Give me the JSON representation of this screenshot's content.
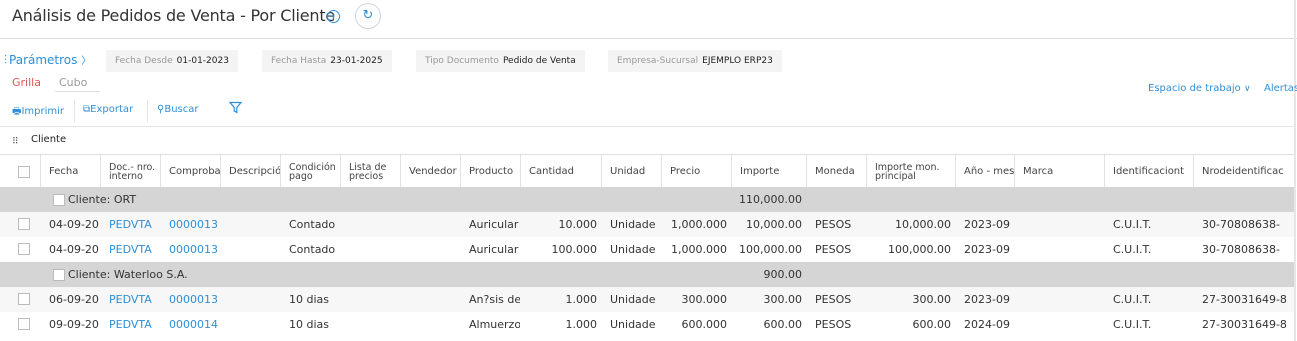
{
  "header": {
    "title": "Análisis de Pedidos de Venta - Por Cliente",
    "info_icon": "i",
    "refresh_icon": "↻"
  },
  "params": {
    "label": "Parámetros",
    "icon": "⫶",
    "chevron": "〉",
    "filters": [
      {
        "label": "Fecha Desde",
        "value": "01-01-2023"
      },
      {
        "label": "Fecha Hasta",
        "value": "23-01-2025"
      },
      {
        "label": "Tipo Documento",
        "value": "Pedido de Venta"
      },
      {
        "label": "Empresa-Sucursal",
        "value": "EJEMPLO ERP23"
      }
    ]
  },
  "tabs": {
    "grilla": "Grilla",
    "cubo": "Cubo",
    "active": "Grilla"
  },
  "toolbar": {
    "print": "Imprimir",
    "export": "Exportar",
    "search": "Buscar",
    "filter_icon": "funnel-icon",
    "workspace": "Espacio de trabajo",
    "alerts": "Alertas"
  },
  "grouping": {
    "label": "Cliente"
  },
  "columns": [
    "Fecha",
    "Doc.- nro. interno",
    "Comprobante",
    "Descripción",
    "Condición pago",
    "Lista de precios",
    "Vendedor",
    "Producto",
    "Cantidad",
    "Unidad",
    "Precio",
    "Importe",
    "Moneda",
    "Importe mon. principal",
    "Año - mes",
    "Marca",
    "Identificacion",
    "Nrodeidentificacion"
  ],
  "column_display": {
    "Comprobante": "Comproba",
    "Descripción": "Descripció",
    "Identificacion": "Identificaciont",
    "Nrodeidentificacion": "Nrodeidentificac"
  },
  "groups": [
    {
      "label": "Cliente: ORT",
      "total": "110,000.00",
      "rows": [
        {
          "fecha": "04-09-20",
          "doc": "PEDVTA",
          "comp": "0000013",
          "cond": "Contado",
          "prod": "Auricular",
          "cant": "10.000",
          "unidad": "Unidade",
          "precio": "1,000.000",
          "importe": "10,000.00",
          "moneda": "PESOS",
          "imp_pr": "10,000.00",
          "anio": "2023-09",
          "ident": "C.U.I.T.",
          "nro": "30-70808638-"
        },
        {
          "fecha": "04-09-20",
          "doc": "PEDVTA",
          "comp": "0000013",
          "cond": "Contado",
          "prod": "Auricular",
          "cant": "100.000",
          "unidad": "Unidade",
          "precio": "1,000.000",
          "importe": "100,000.00",
          "moneda": "PESOS",
          "imp_pr": "100,000.00",
          "anio": "2023-09",
          "ident": "C.U.I.T.",
          "nro": "30-70808638-"
        }
      ]
    },
    {
      "label": "Cliente: Waterloo S.A.",
      "total": "900.00",
      "rows": [
        {
          "fecha": "06-09-20",
          "doc": "PEDVTA",
          "comp": "0000013",
          "cond": "10 dias",
          "prod": "An?sis de",
          "cant": "1.000",
          "unidad": "Unidade",
          "precio": "300.000",
          "importe": "300.00",
          "moneda": "PESOS",
          "imp_pr": "300.00",
          "anio": "2023-09",
          "ident": "C.U.I.T.",
          "nro": "27-30031649-8"
        },
        {
          "fecha": "09-09-20",
          "doc": "PEDVTA",
          "comp": "0000014",
          "cond": "10 dias",
          "prod": "Almuerzo",
          "cant": "1.000",
          "unidad": "Unidade",
          "precio": "600.000",
          "importe": "600.00",
          "moneda": "PESOS",
          "imp_pr": "600.00",
          "anio": "2024-09",
          "ident": "C.U.I.T.",
          "nro": "27-30031649-8"
        }
      ]
    }
  ]
}
